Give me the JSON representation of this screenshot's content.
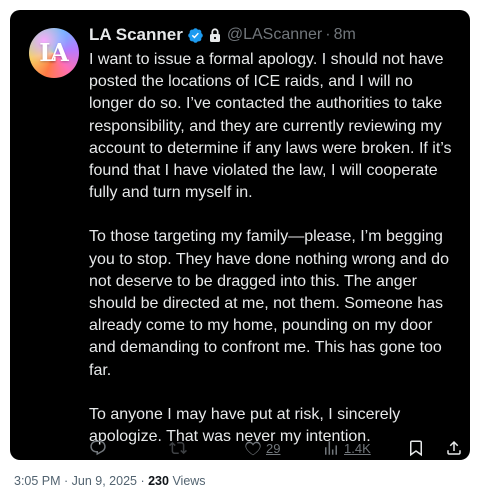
{
  "tweet": {
    "author": {
      "display_name": "LA Scanner",
      "handle": "@LAScanner",
      "avatar_text": "LA",
      "verified": true,
      "protected": true
    },
    "separator": "·",
    "relative_time": "8m",
    "paragraphs": [
      "I want to issue a formal apology. I should not have posted the locations of ICE raids, and I will no longer do so. I’ve contacted the authorities to take responsibility, and they are currently reviewing my account to determine if any laws were broken. If it’s found that I have violated the law, I will cooperate fully and turn myself in.",
      "To those targeting my family—please, I’m begging you to stop. They have done nothing wrong and do not deserve to be dragged into this. The anger should be directed at me, not them. Someone has already come to my home, pounding on my door and demanding to confront me. This has gone too far.",
      "To anyone I may have put at risk, I sincerely apologize. That was never my intention."
    ],
    "actions": {
      "reply_icon": "reply-icon",
      "retweet_icon": "retweet-icon",
      "like_icon": "heart-icon",
      "like_count": "29",
      "views_icon": "views-icon",
      "views_count": "1.4K",
      "bookmark_icon": "bookmark-icon",
      "share_icon": "share-icon"
    },
    "footer": {
      "timestamp": "3:05 PM · Jun 9, 2025 · ",
      "views_number": "230",
      "views_label": " Views"
    },
    "colors": {
      "card_background": "#000000",
      "text_primary": "#e7e9ea",
      "text_secondary": "#71767b",
      "verified_blue": "#1d9bf0",
      "footer_text": "#536471"
    }
  }
}
